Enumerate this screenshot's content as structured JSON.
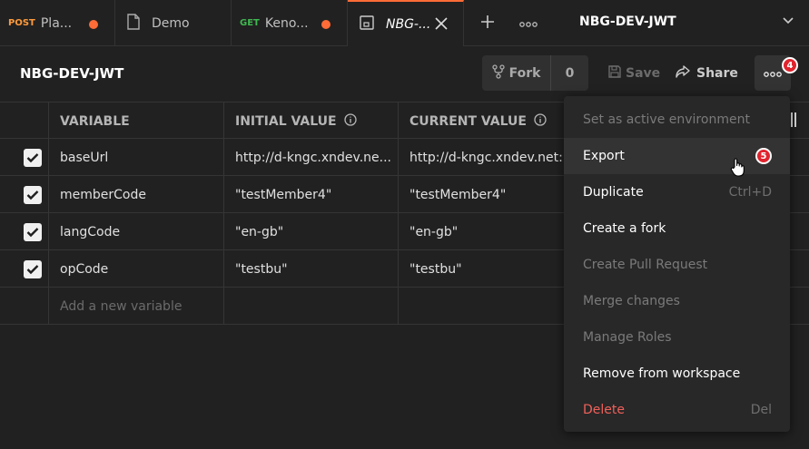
{
  "tabs": [
    {
      "method": "POST",
      "method_color": "#ff9a3c",
      "name": "Pla...",
      "dirty": true
    },
    {
      "method": "",
      "name": "Demo",
      "dirty": false
    },
    {
      "method": "GET",
      "method_color": "#3fb950",
      "name": "Keno...",
      "dirty": true
    },
    {
      "method": "",
      "name": "NBG-...",
      "dirty": false,
      "active": true
    }
  ],
  "environment_selector": {
    "label": "NBG-DEV-JWT"
  },
  "header": {
    "title": "NBG-DEV-JWT",
    "fork_label": "Fork",
    "fork_count": "0",
    "save_label": "Save",
    "share_label": "Share",
    "more_badge": "4"
  },
  "table": {
    "columns": [
      "VARIABLE",
      "INITIAL VALUE",
      "CURRENT VALUE"
    ],
    "rows": [
      {
        "variable": "baseUrl",
        "initial": "http://d-kngc.xndev.ne...",
        "current": "http://d-kngc.xndev.net:",
        "checked": true
      },
      {
        "variable": "memberCode",
        "initial": "\"testMember4\"",
        "current": "\"testMember4\"",
        "checked": true
      },
      {
        "variable": "langCode",
        "initial": "\"en-gb\"",
        "current": "\"en-gb\"",
        "checked": true
      },
      {
        "variable": "opCode",
        "initial": "\"testbu\"",
        "current": "\"testbu\"",
        "checked": true
      }
    ],
    "add_placeholder": "Add a new variable"
  },
  "menu": {
    "items": [
      {
        "label": "Set as active environment",
        "disabled": true,
        "shortcut": ""
      },
      {
        "label": "Export",
        "disabled": false,
        "shortcut": "",
        "badge": "5"
      },
      {
        "label": "Duplicate",
        "disabled": false,
        "shortcut": "Ctrl+D"
      },
      {
        "label": "Create a fork",
        "disabled": false,
        "shortcut": ""
      },
      {
        "label": "Create Pull Request",
        "disabled": true,
        "shortcut": ""
      },
      {
        "label": "Merge changes",
        "disabled": true,
        "shortcut": ""
      },
      {
        "label": "Manage Roles",
        "disabled": true,
        "shortcut": ""
      },
      {
        "label": "Remove from workspace",
        "disabled": false,
        "shortcut": ""
      },
      {
        "label": "Delete",
        "disabled": false,
        "danger": true,
        "shortcut": "Del"
      }
    ]
  },
  "colors": {
    "accent": "#ff6c37",
    "badge": "#e0242e",
    "danger": "#f0605a"
  }
}
